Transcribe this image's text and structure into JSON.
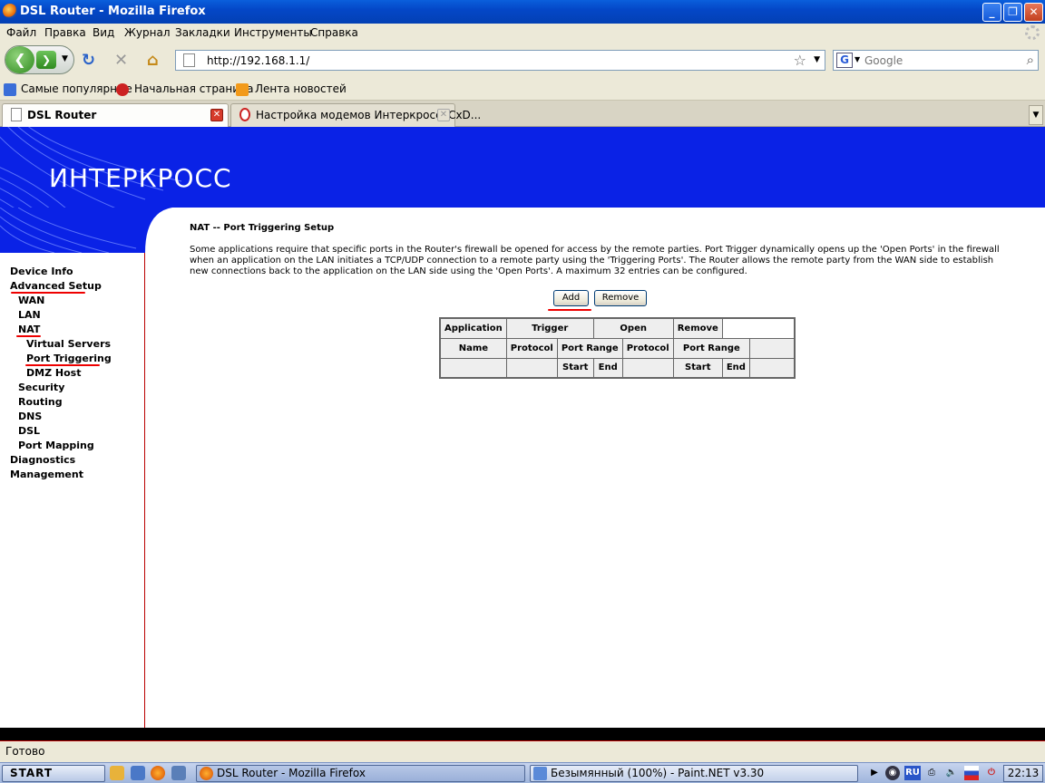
{
  "window": {
    "title": "DSL Router - Mozilla Firefox"
  },
  "menu": [
    "Файл",
    "Правка",
    "Вид",
    "Журнал",
    "Закладки",
    "Инструменты",
    "Справка"
  ],
  "nav": {
    "url": "http://192.168.1.1/",
    "search_placeholder": "Google"
  },
  "bookmarks": [
    "Самые популярные",
    "Начальная страница",
    "Лента новостей"
  ],
  "tabs": [
    {
      "label": "DSL Router",
      "active": true
    },
    {
      "label": "Настройка модемов Интеркросс ICxD...",
      "active": false
    }
  ],
  "page": {
    "logo": "ИНТЕРКРОСС",
    "title": "NAT -- Port Triggering Setup",
    "description": "Some applications require that specific ports in the Router's firewall be opened for access by the remote parties. Port Trigger dynamically opens up the 'Open Ports' in the firewall when an application on the LAN initiates a TCP/UDP connection to a remote party using the 'Triggering Ports'. The Router allows the remote party from the WAN side to establish new connections back to the application on the LAN side using the 'Open Ports'. A maximum 32 entries can be configured.",
    "add_label": "Add",
    "remove_label": "Remove",
    "table": {
      "h_application": "Application",
      "h_trigger": "Trigger",
      "h_open": "Open",
      "h_remove": "Remove",
      "h_name": "Name",
      "h_protocol": "Protocol",
      "h_port_range": "Port Range",
      "h_start": "Start",
      "h_end": "End"
    }
  },
  "sidebar": [
    "Device Info",
    "Advanced Setup",
    "WAN",
    "LAN",
    "NAT",
    "Virtual Servers",
    "Port Triggering",
    "DMZ Host",
    "Security",
    "Routing",
    "DNS",
    "DSL",
    "Port Mapping",
    "Diagnostics",
    "Management"
  ],
  "status": "Готово",
  "taskbar": {
    "start": "START",
    "tasks": [
      "DSL Router - Mozilla Firefox",
      "Безымянный (100%) - Paint.NET v3.30"
    ],
    "lang": "RU",
    "clock": "22:13"
  },
  "colors": {
    "banner": "#0a22e6",
    "underline": "#e00000",
    "titlebar": "#0447c7"
  }
}
